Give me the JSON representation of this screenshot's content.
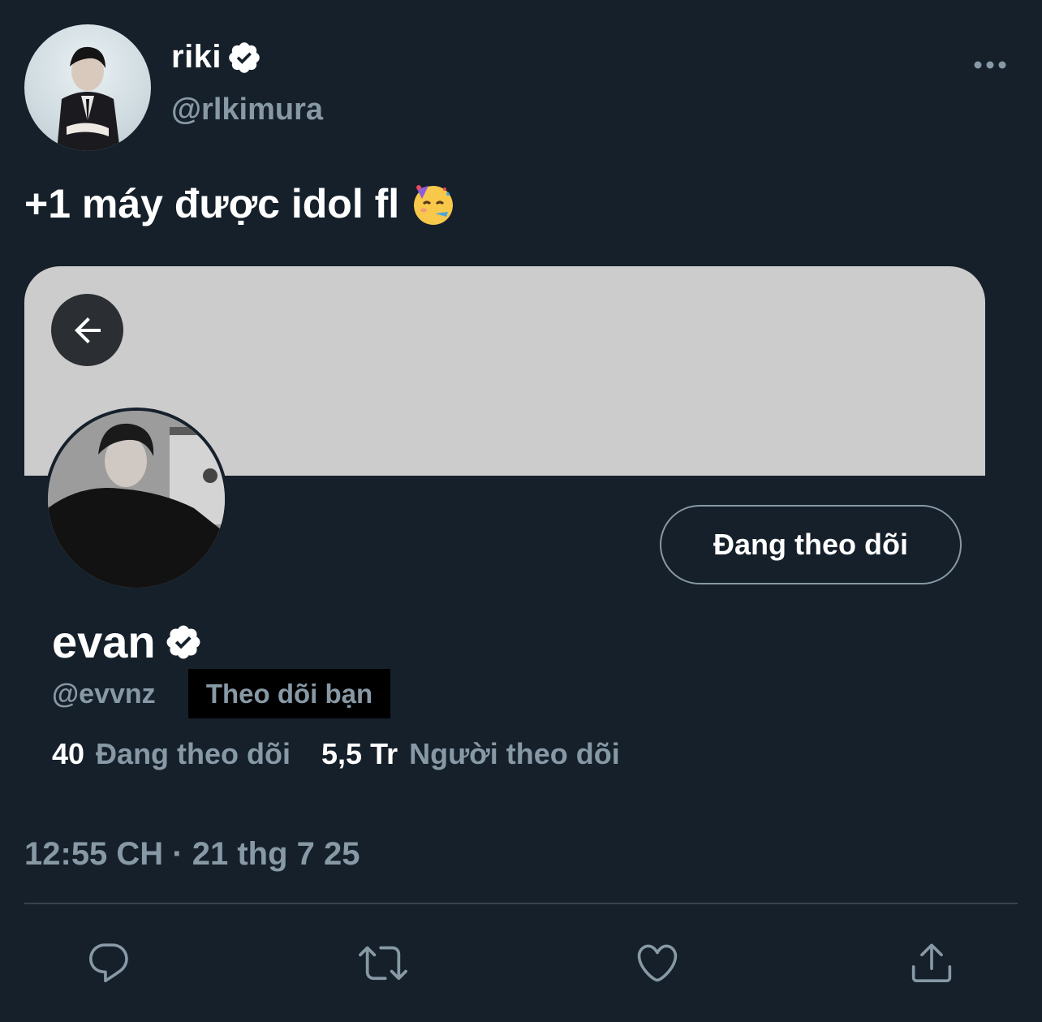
{
  "author": {
    "name": "riki",
    "handle": "@rlkimura",
    "verified": true
  },
  "tweet": {
    "text": "+1 máy được idol fl",
    "emoji": "partying-face-emoji",
    "timestamp": "12:55 CH · 21 thg 7 25"
  },
  "embedded_profile": {
    "name": "evan",
    "handle": "@evvnz",
    "verified": true,
    "follows_you_label": "Theo dõi bạn",
    "follow_button_label": "Đang theo dõi",
    "following_count": "40",
    "following_label": "Đang theo dõi",
    "followers_count": "5,5 Tr",
    "followers_label": "Người theo dõi",
    "banner_color": "#cccccc"
  },
  "actions": [
    "reply-icon",
    "retweet-icon",
    "like-icon",
    "share-icon"
  ],
  "colors": {
    "background": "#15202b",
    "secondary_text": "#8899a6",
    "divider": "#38444d",
    "verified_badge": "#ffffff"
  }
}
